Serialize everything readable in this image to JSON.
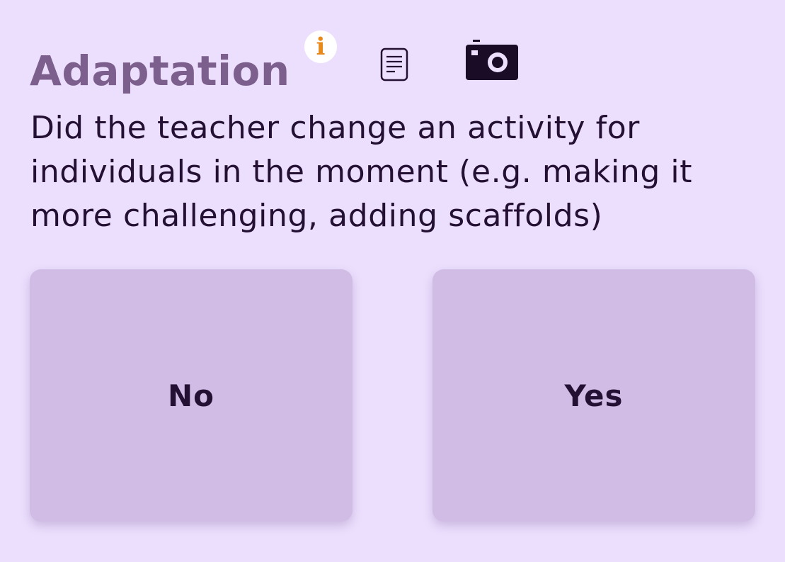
{
  "header": {
    "title": "Adaptation",
    "info_icon": "info-icon",
    "info_glyph": "i",
    "notes_icon": "document-icon",
    "camera_icon": "camera-icon"
  },
  "question": {
    "text": "Did the teacher change an activity for individuals in the moment (e.g. making it more challenging, adding scaffolds)"
  },
  "choices": [
    {
      "label": "No"
    },
    {
      "label": "Yes"
    }
  ],
  "colors": {
    "background": "#ecdffd",
    "title": "#7d5f8e",
    "info_accent": "#e8891c",
    "choice_bg": "#d1bce5",
    "text": "#241033"
  }
}
